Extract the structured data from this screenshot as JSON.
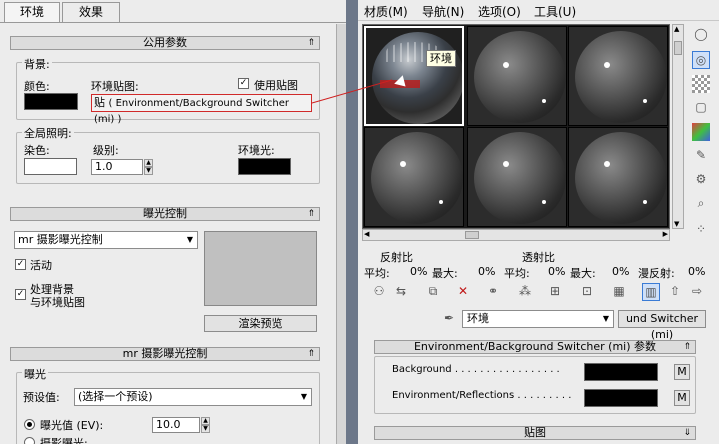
{
  "env_dialog": {
    "tabs": [
      "环境",
      "效果"
    ],
    "common_params": {
      "title": "公用参数",
      "background_label": "背景:",
      "color_label": "颜色:",
      "env_map_label": "环境贴图:",
      "use_map_label": "使用贴图",
      "env_map_button": "( Environment/Background Switcher (mi) )",
      "env_map_prefix": "贴",
      "global_lighting_label": "全局照明:",
      "tint_label": "染色:",
      "level_label": "级别:",
      "level_value": "1.0",
      "ambient_label": "环境光:",
      "colors": {
        "bg": "#000000",
        "tint": "#ffffff",
        "ambient": "#000000"
      }
    },
    "exposure_control": {
      "title": "曝光控制",
      "dropdown_value": "mr 摄影曝光控制",
      "active_label": "活动",
      "process_bg_label_1": "处理背景",
      "process_bg_label_2": "与环境贴图",
      "render_preview_label": "渲染预览"
    },
    "mr_exposure": {
      "title": "mr 摄影曝光控制",
      "exposure_label": "曝光",
      "preset_label": "预设值:",
      "preset_value": "(选择一个预设)",
      "ev_label": "曝光值 (EV):",
      "ev_value": "10.0",
      "photo_exposure_label": "摄影曝光:"
    }
  },
  "material_editor": {
    "menus": [
      "材质(M)",
      "导航(N)",
      "选项(O)",
      "工具(U)"
    ],
    "tooltip": "环境",
    "stats": {
      "reflect_label": "反射比",
      "transmit_label": "透射比",
      "avg_label": "平均:",
      "avg_value": "0%",
      "max_label": "最大:",
      "max_value": "0%",
      "avg2_label": "平均:",
      "avg2_value": "0%",
      "max2_label": "最大:",
      "max2_value": "0%",
      "diffuse_label": "漫反射:",
      "diffuse_value": "0%"
    },
    "material_name": "环境",
    "material_type": "und Switcher (mi)",
    "param_rollout": {
      "title": "Environment/Background Switcher (mi) 参数",
      "background_label": "Background . . . . . . . . . . . . . . . . .",
      "reflections_label": "Environment/Reflections . . . . . . . . .",
      "m_label": "M"
    },
    "maps_rollout": {
      "title": "贴图"
    },
    "icons": [
      "sphere-icon",
      "backlight-icon",
      "checker-icon",
      "sample-uv-icon",
      "color-icon",
      "measure-icon",
      "options-icon",
      "magnify-icon",
      "select-icon"
    ],
    "toolbar_icons": [
      "get-material-icon",
      "put-to-scene-icon",
      "assign-icon",
      "delete-icon",
      "make-copy-icon",
      "unique-icon",
      "library-icon",
      "material-id-icon",
      "show-map-icon",
      "show-result-icon",
      "go-parent-icon",
      "go-sibling-icon"
    ]
  }
}
